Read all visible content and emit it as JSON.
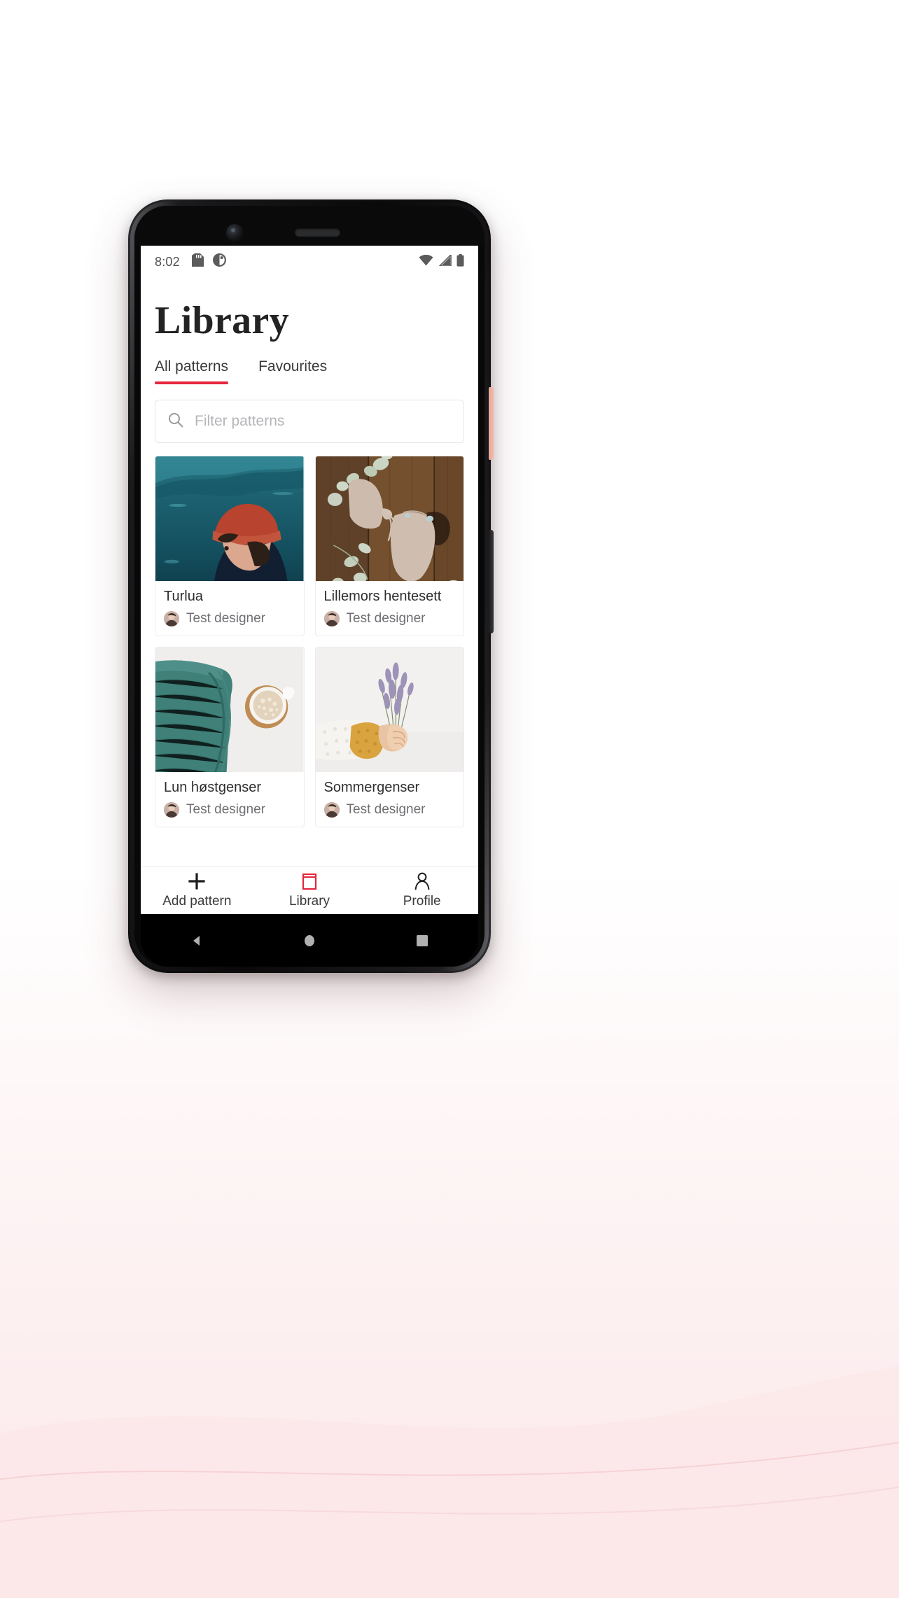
{
  "status_bar": {
    "time": "8:02",
    "left_icons": [
      "sd-card-icon",
      "do-not-disturb-icon"
    ],
    "right_icons": [
      "wifi-icon",
      "cellular-signal-icon",
      "battery-icon"
    ]
  },
  "app": {
    "title": "Library",
    "accent_color": "#e5253d"
  },
  "tabs": [
    {
      "label": "All patterns",
      "active": true
    },
    {
      "label": "Favourites",
      "active": false
    }
  ],
  "search": {
    "placeholder": "Filter patterns",
    "value": "",
    "icon": "search-icon"
  },
  "patterns": [
    {
      "title": "Turlua",
      "author": "Test designer",
      "image": "man-red-beanie-mountain"
    },
    {
      "title": "Lillemors hentesett",
      "author": "Test designer",
      "image": "knit-baby-set-wood"
    },
    {
      "title": "Lun høstgenser",
      "author": "Test designer",
      "image": "teal-sweater-coffee"
    },
    {
      "title": "Sommergenser",
      "author": "Test designer",
      "image": "hand-holding-lavender"
    }
  ],
  "bottom_nav": [
    {
      "label": "Add pattern",
      "icon": "plus-icon",
      "active": false
    },
    {
      "label": "Library",
      "icon": "book-icon",
      "active": true
    },
    {
      "label": "Profile",
      "icon": "person-icon",
      "active": false
    }
  ],
  "android_nav": [
    "back-button",
    "home-button",
    "recents-button"
  ]
}
